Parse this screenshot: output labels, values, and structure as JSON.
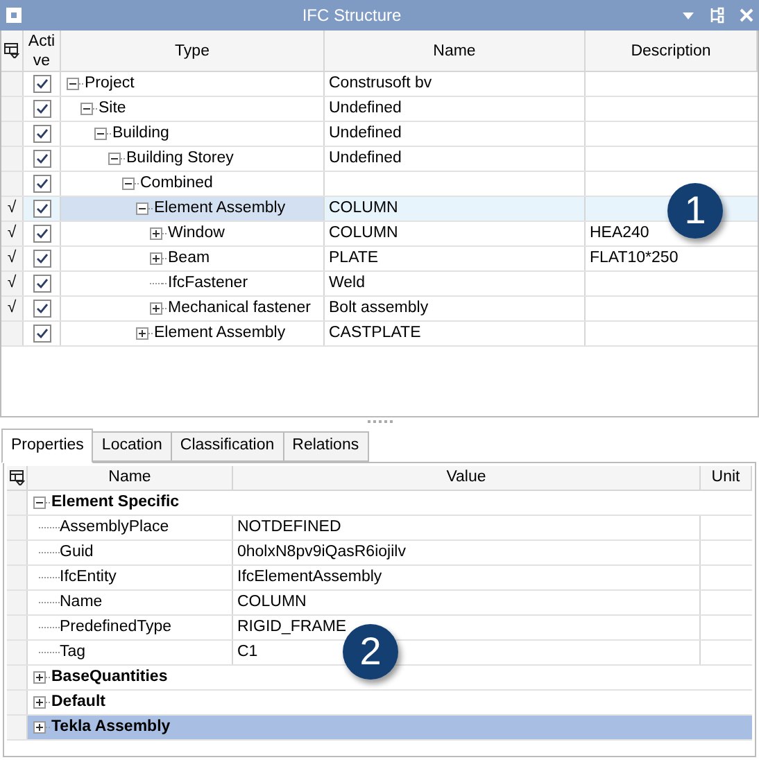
{
  "window": {
    "title": "IFC Structure"
  },
  "tree": {
    "columns": [
      "Active",
      "Type",
      "Name",
      "Description"
    ],
    "nodes": [
      {
        "type": "Project",
        "name": "Construsoft bv",
        "active": true,
        "selected": false,
        "expanded": true,
        "children": [
          {
            "type": "Site",
            "name": "Undefined",
            "active": true,
            "selected": false,
            "expanded": true,
            "children": [
              {
                "type": "Building",
                "name": "Undefined",
                "active": true,
                "selected": false,
                "expanded": true,
                "children": [
                  {
                    "type": "Building Storey",
                    "name": "Undefined",
                    "active": true,
                    "selected": false,
                    "expanded": true,
                    "children": [
                      {
                        "type": "Combined",
                        "active": true,
                        "selected": false,
                        "expanded": true,
                        "children": [
                          {
                            "type": "Element Assembly",
                            "name": "COLUMN",
                            "mark": "√",
                            "active": true,
                            "selected": true,
                            "expanded": true,
                            "children": [
                              {
                                "type": "Window",
                                "name": "COLUMN",
                                "description": "HEA240",
                                "mark": "√",
                                "active": true,
                                "selected": false,
                                "expanded": false
                              },
                              {
                                "type": "Beam",
                                "name": "PLATE",
                                "description": "FLAT10*250",
                                "mark": "√",
                                "active": true,
                                "selected": false,
                                "expanded": false
                              },
                              {
                                "type": "IfcFastener",
                                "name": "Weld",
                                "mark": "√",
                                "active": true,
                                "selected": false
                              },
                              {
                                "type": "Mechanical fastener",
                                "name": "Bolt assembly",
                                "mark": "√",
                                "active": true,
                                "selected": false,
                                "expanded": false
                              }
                            ]
                          },
                          {
                            "type": "Element Assembly",
                            "name": "CASTPLATE",
                            "active": true,
                            "selected": false,
                            "expanded": false
                          }
                        ]
                      }
                    ]
                  }
                ]
              }
            ]
          }
        ]
      }
    ]
  },
  "callouts": [
    "1",
    "2"
  ],
  "tabs": [
    {
      "label": "Properties",
      "selected": true
    },
    {
      "label": "Location",
      "selected": false
    },
    {
      "label": "Classification",
      "selected": false
    },
    {
      "label": "Relations",
      "selected": false
    }
  ],
  "properties": {
    "columns": [
      "Name",
      "Value",
      "Unit"
    ],
    "groups": [
      {
        "name": "Element Specific",
        "expanded": true,
        "selected": false,
        "items": [
          {
            "name": "AssemblyPlace",
            "value": "NOTDEFINED"
          },
          {
            "name": "Guid",
            "value": "0holxN8pv9iQasR6iojilv"
          },
          {
            "name": "IfcEntity",
            "value": "IfcElementAssembly"
          },
          {
            "name": "Name",
            "value": "COLUMN"
          },
          {
            "name": "PredefinedType",
            "value": "RIGID_FRAME"
          },
          {
            "name": "Tag",
            "value": "C1"
          }
        ]
      },
      {
        "name": "BaseQuantities",
        "expanded": false,
        "selected": false
      },
      {
        "name": "Default",
        "expanded": false,
        "selected": false
      },
      {
        "name": "Tekla Assembly",
        "expanded": false,
        "selected": true
      }
    ]
  }
}
